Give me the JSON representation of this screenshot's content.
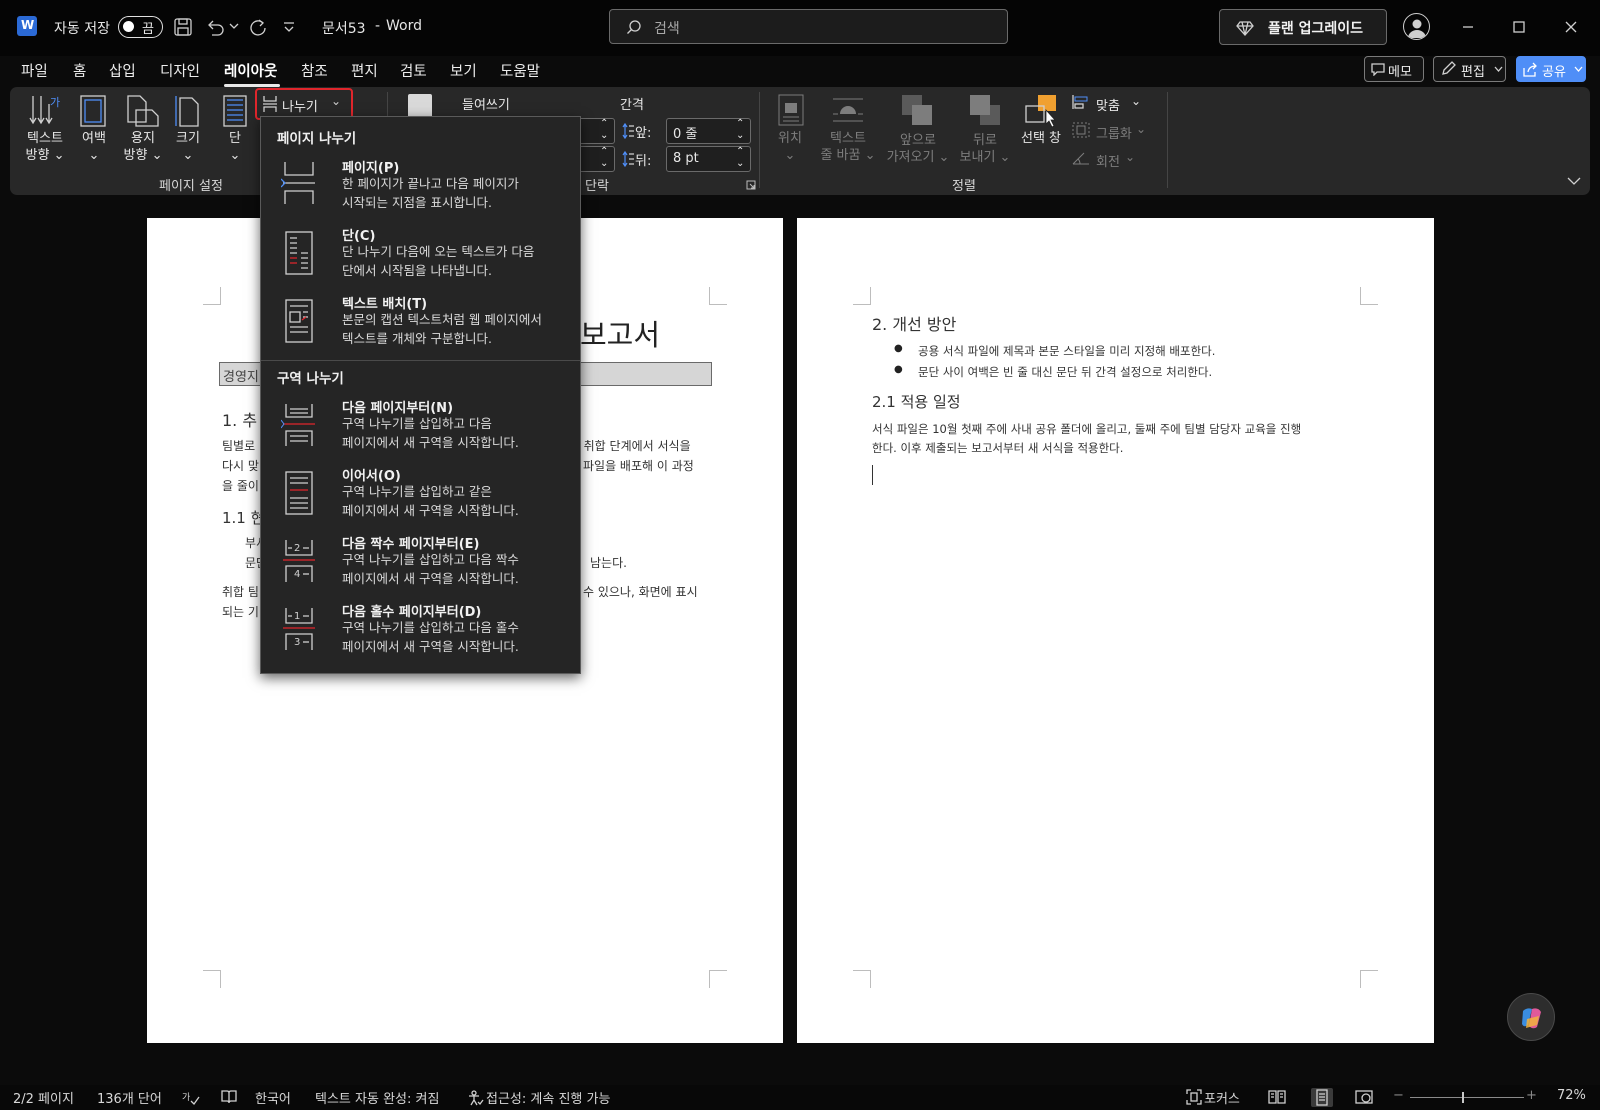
{
  "titlebar": {
    "autosave_label": "자동 저장",
    "autosave_state": "끔",
    "doc_title": "문서53",
    "title_sep": "-",
    "app_name": "Word",
    "search_placeholder": "검색",
    "upgrade_label": "플랜 업그레이드"
  },
  "menu": {
    "tabs": [
      "파일",
      "홈",
      "삽입",
      "디자인",
      "레이아웃",
      "참조",
      "편지",
      "검토",
      "보기",
      "도움말"
    ],
    "active_tab": "레이아웃",
    "memo": "메모",
    "edit": "편집",
    "share": "공유"
  },
  "ribbon": {
    "text_direction": [
      "텍스트",
      "방향"
    ],
    "margins": "여백",
    "orientation": [
      "용지",
      "방향"
    ],
    "size": "크기",
    "columns": "단",
    "breaks": "나누기",
    "page_setup_group": "페이지 설정",
    "indent_label": "들여쓰기",
    "spacing_label": "간격",
    "before_label": "앞:",
    "before_value": "0 줄",
    "after_label": "뒤:",
    "after_value": "8 pt",
    "paragraph_group": "단락",
    "position": "위치",
    "wrap_text": [
      "텍스트",
      "줄 바꿈"
    ],
    "bring_forward": [
      "앞으로",
      "가져오기"
    ],
    "send_backward": [
      "뒤로",
      "보내기"
    ],
    "selection_pane": "선택 창",
    "align": "맞춤",
    "group": "그룹화",
    "rotate": "회전",
    "arrange_group": "정렬"
  },
  "dropdown": {
    "page_breaks_header": "페이지 나누기",
    "section_breaks_header": "구역 나누기",
    "items": [
      {
        "title": "페이지(P)",
        "desc": [
          "한 페이지가 끝나고 다음 페이지가",
          "시작되는 지점을 표시합니다."
        ]
      },
      {
        "title": "단(C)",
        "desc": [
          "단 나누기 다음에 오는 텍스트가 다음",
          "단에서 시작됨을 나타냅니다."
        ]
      },
      {
        "title": "텍스트 배치(T)",
        "desc": [
          "본문의 캡션 텍스트처럼 웹 페이지에서",
          "텍스트를 개체와 구분합니다."
        ]
      },
      {
        "title": "다음 페이지부터(N)",
        "desc": [
          "구역 나누기를 삽입하고 다음",
          "페이지에서 새 구역을 시작합니다."
        ]
      },
      {
        "title": "이어서(O)",
        "desc": [
          "구역 나누기를 삽입하고 같은",
          "페이지에서 새 구역을 시작합니다."
        ]
      },
      {
        "title": "다음 짝수 페이지부터(E)",
        "desc": [
          "구역 나누기를 삽입하고 다음 짝수",
          "페이지에서 새 구역을 시작합니다."
        ]
      },
      {
        "title": "다음 홀수 페이지부터(D)",
        "desc": [
          "구역 나누기를 삽입하고 다음 홀수",
          "페이지에서 새 구역을 시작합니다."
        ]
      }
    ]
  },
  "page1": {
    "title_visible": "보고서",
    "box_text": "경영지",
    "h1": "1. 추",
    "p1": [
      "팀별로",
      "다시 맞",
      "을 줄이"
    ],
    "p1_right": [
      ", 취합 단계에서 서식을",
      "파일을 배포해 이 과정"
    ],
    "h11": "1.1 현",
    "list": [
      "부서",
      "문단"
    ],
    "list_right": "남는다.",
    "p2": [
      "취합 팀",
      "되는 기"
    ],
    "p2_right": "수 있으나, 화면에 표시"
  },
  "page2": {
    "h2": "2. 개선 방안",
    "bullets": [
      "공용 서식 파일에 제목과 본문 스타일을 미리 지정해 배포한다.",
      "문단 사이 여백은 빈 줄 대신 문단 뒤 간격 설정으로 처리한다."
    ],
    "h21": "2.1 적용 일정",
    "para": [
      "서식 파일은 10월 첫째 주에 사내 공유 폴더에 올리고, 둘째 주에 팀별 담당자 교육을 진행",
      "한다. 이후 제출되는 보고서부터 새 서식을 적용한다."
    ]
  },
  "status": {
    "page": "2/2 페이지",
    "words": "136개 단어",
    "language": "한국어",
    "autocomplete": "텍스트 자동 완성: 켜짐",
    "accessibility": "접근성: 계속 진행 가능",
    "focus": "포커스",
    "zoom": "72%"
  },
  "colors": {
    "accent_red": "#e0262c",
    "share_blue": "#4f8ef7",
    "word_blue": "#2b6ad6",
    "selection_orange": "#f0a030"
  }
}
